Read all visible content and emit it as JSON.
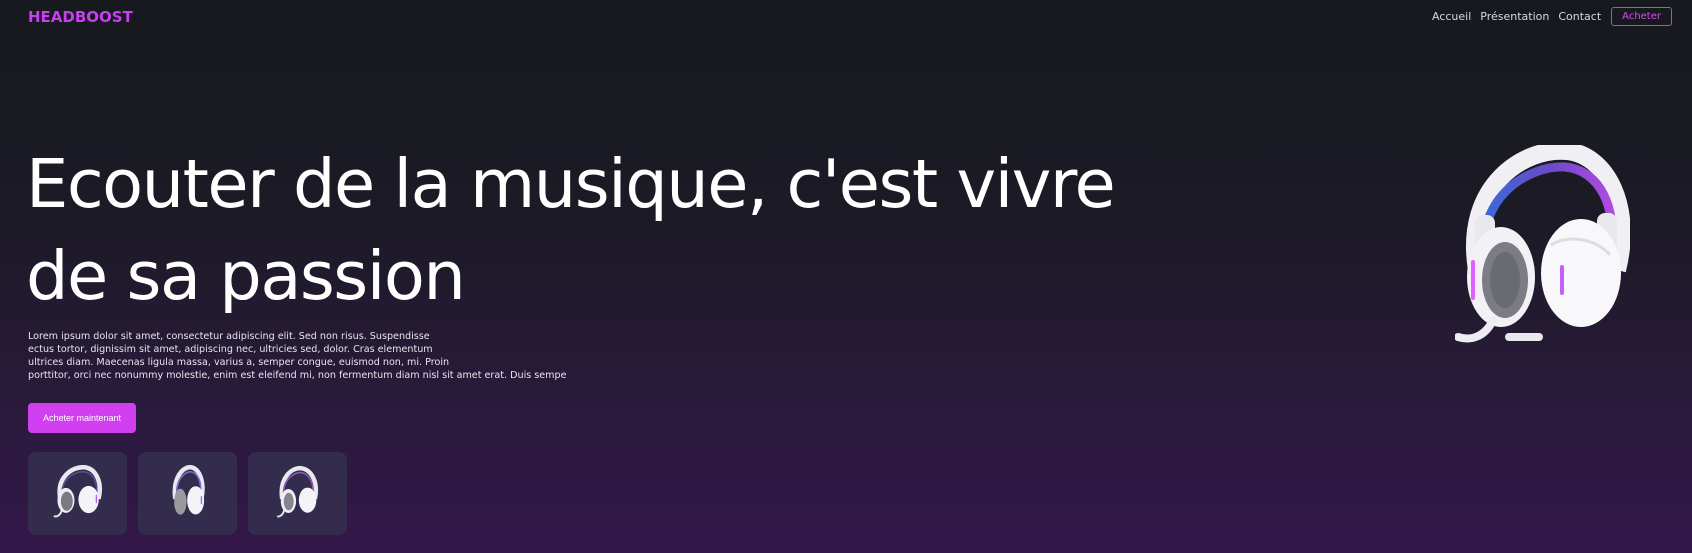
{
  "nav": {
    "brand": "HEADBOOST",
    "links": [
      "Accueil",
      "Présentation",
      "Contact"
    ],
    "cta": "Acheter"
  },
  "hero": {
    "title": "Ecouter de la musique, c'est vivre de sa passion",
    "paragraph_lines": [
      "Lorem ipsum dolor sit amet, consectetur adipiscing elit. Sed non risus. Suspendisse",
      "ectus tortor, dignissim sit amet, adipiscing nec, ultricies sed, dolor. Cras elementum",
      "ultrices diam. Maecenas ligula massa, varius a, semper congue, euismod non, mi. Proin",
      "porttitor, orci nec nonummy molestie, enim est eleifend mi, non fermentum diam nisl sit amet erat. Duis sempe"
    ],
    "button": "Acheter maintenant",
    "image_icon": "headset-icon"
  },
  "thumbnails": [
    {
      "icon": "headset-icon"
    },
    {
      "icon": "headset-icon"
    },
    {
      "icon": "headset-icon"
    }
  ],
  "colors": {
    "accent": "#d23ff0",
    "brand": "#c93ef0",
    "thumb_bg": "#332c4d",
    "background_top": "#16191e",
    "background_bottom": "#34174a"
  }
}
